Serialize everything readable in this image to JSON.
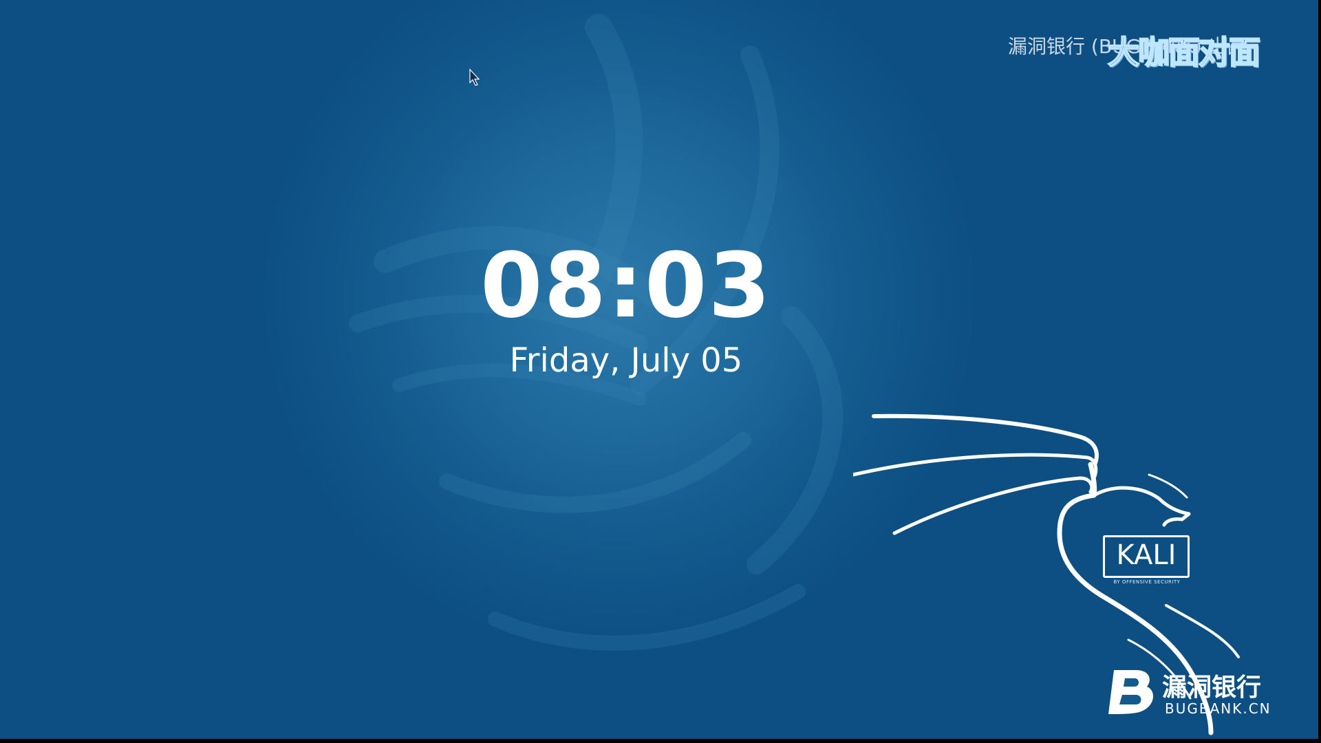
{
  "lock_screen": {
    "time": "08:03",
    "date": "Friday, July 05"
  },
  "watermark_top": {
    "text": "漏洞银行 (BUGBANK) 出品",
    "overlay": "大咖面对面"
  },
  "kali_logo": {
    "badge_text": "KALI",
    "subtitle": "BY OFFENSIVE SECURITY"
  },
  "bugbank_logo": {
    "chinese": "漏洞银行",
    "domain": "BUGBANK.CN"
  },
  "colors": {
    "background": "#135a8d",
    "glow": "#2c79aa",
    "text": "#ffffff"
  },
  "icons": [
    "mouse-pointer-icon",
    "kali-dragon-icon",
    "bugbank-b-icon"
  ]
}
